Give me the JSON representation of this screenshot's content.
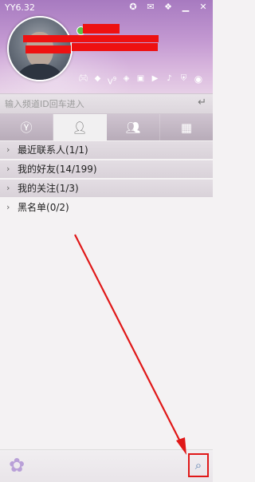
{
  "window": {
    "title": "YY6.32"
  },
  "header": {
    "system_icons": [
      "medal-icon",
      "mail-icon",
      "shirt-icon",
      "minimize-icon",
      "close-icon"
    ],
    "badges": [
      "gamepad-icon",
      "diamond-icon",
      "vip-icon",
      "diamond2-icon",
      "video-icon",
      "play-icon",
      "music-icon",
      "shield-icon"
    ],
    "vip_level": "9"
  },
  "channel": {
    "placeholder": "输入频道ID回车进入"
  },
  "tabs": [
    {
      "name": "tab-yy",
      "icon": "y-icon"
    },
    {
      "name": "tab-contacts",
      "icon": "person-icon",
      "active": true
    },
    {
      "name": "tab-groups",
      "icon": "people-icon"
    },
    {
      "name": "tab-apps",
      "icon": "apps-icon"
    }
  ],
  "groups": [
    {
      "label": "最近联系人",
      "count": "(1/1)"
    },
    {
      "label": "我的好友",
      "count": "(14/199)"
    },
    {
      "label": "我的关注",
      "count": "(1/3)"
    },
    {
      "label": "黑名单",
      "count": "(0/2)"
    }
  ],
  "colors": {
    "highlight": "#e01818",
    "header": "#b88ac8"
  }
}
